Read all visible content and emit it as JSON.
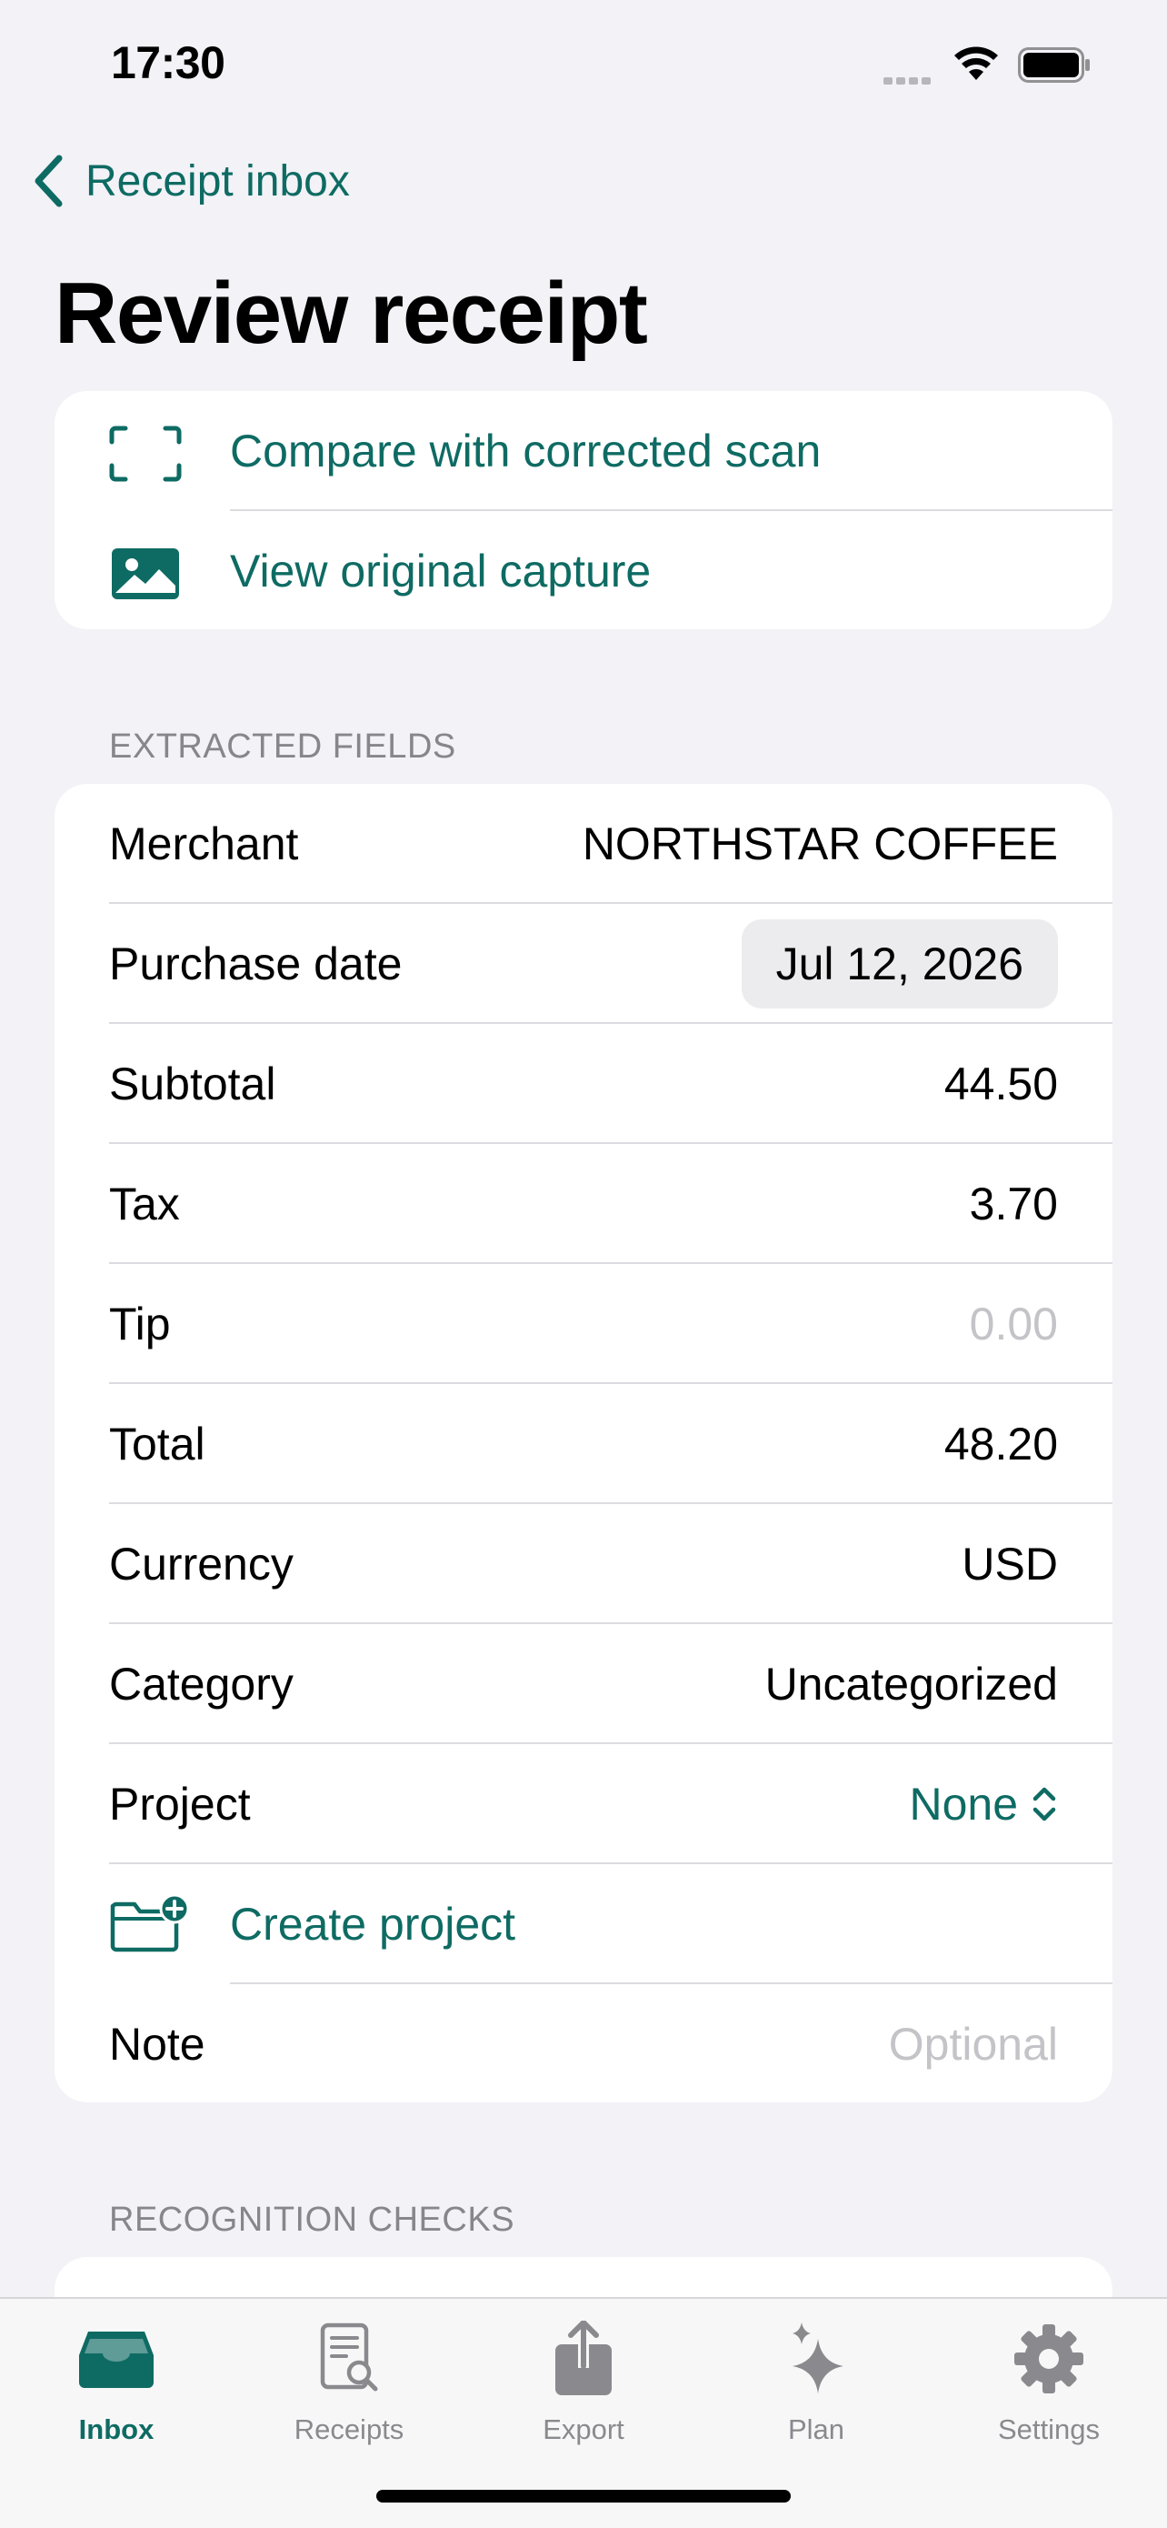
{
  "status_bar": {
    "time": "17:30"
  },
  "nav": {
    "back_label": "Receipt inbox",
    "title": "Review receipt"
  },
  "actions": [
    {
      "label": "Compare with corrected scan",
      "icon": "scan-frame-icon"
    },
    {
      "label": "View original capture",
      "icon": "photo-icon"
    }
  ],
  "extracted": {
    "header": "EXTRACTED FIELDS",
    "fields": [
      {
        "label": "Merchant",
        "value": "NORTHSTAR COFFEE"
      },
      {
        "label": "Purchase date",
        "value": "Jul 12, 2026"
      },
      {
        "label": "Subtotal",
        "value": "44.50"
      },
      {
        "label": "Tax",
        "value": "3.70"
      },
      {
        "label": "Tip",
        "placeholder": "0.00"
      },
      {
        "label": "Total",
        "value": "48.20"
      },
      {
        "label": "Currency",
        "value": "USD"
      },
      {
        "label": "Category",
        "value": "Uncategorized"
      },
      {
        "label": "Project",
        "value": "None"
      }
    ],
    "create_project_label": "Create project",
    "note": {
      "label": "Note",
      "placeholder": "Optional"
    }
  },
  "recognition": {
    "header": "RECOGNITION CHECKS"
  },
  "tabs": [
    {
      "label": "Inbox",
      "icon": "inbox-tray-icon",
      "active": true
    },
    {
      "label": "Receipts",
      "icon": "receipt-search-icon"
    },
    {
      "label": "Export",
      "icon": "share-export-icon"
    },
    {
      "label": "Plan",
      "icon": "sparkles-icon"
    },
    {
      "label": "Settings",
      "icon": "gear-icon"
    }
  ],
  "colors": {
    "accent": "#0e6b63",
    "background": "#f2f2f7",
    "separator": "#dcdce0",
    "placeholder": "#c4c4c8"
  }
}
